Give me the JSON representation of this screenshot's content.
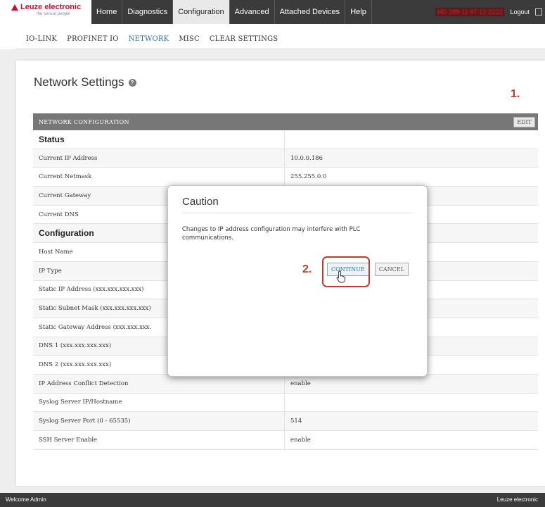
{
  "brand": {
    "name": "Leuze electronic",
    "tagline": "the sensor people"
  },
  "nav": {
    "tabs": [
      "Home",
      "Diagnostics",
      "Configuration",
      "Advanced",
      "Attached Devices",
      "Help"
    ],
    "active": "Configuration",
    "user_info": "MD 288-11-97-12-2222",
    "logout": "Logout"
  },
  "subnav": {
    "items": [
      "IO-LINK",
      "PROFINET IO",
      "NETWORK",
      "MISC",
      "CLEAR SETTINGS"
    ],
    "active": "NETWORK"
  },
  "page": {
    "title": "Network Settings"
  },
  "steps": {
    "one": "1.",
    "two": "2."
  },
  "table": {
    "header": "NETWORK CONFIGURATION",
    "edit_label": "EDIT",
    "rows": [
      {
        "label": "Status",
        "value": "",
        "section": true
      },
      {
        "label": "Current IP Address",
        "value": "10.0.0.186"
      },
      {
        "label": "Current Netmask",
        "value": "255.255.0.0"
      },
      {
        "label": "Current Gateway",
        "value": ""
      },
      {
        "label": "Current DNS",
        "value": ""
      },
      {
        "label": "Configuration",
        "value": "",
        "section": true
      },
      {
        "label": "Host Name",
        "value": ""
      },
      {
        "label": "IP Type",
        "value": ""
      },
      {
        "label": "Static IP Address (xxx.xxx.xxx.xxx)",
        "value": ""
      },
      {
        "label": "Static Subnet Mask (xxx.xxx.xxx.xxx)",
        "value": ""
      },
      {
        "label": "Static Gateway Address (xxx.xxx.xxx.",
        "value": ""
      },
      {
        "label": "DNS 1 (xxx.xxx.xxx.xxx)",
        "value": ""
      },
      {
        "label": "DNS 2 (xxx.xxx.xxx.xxx)",
        "value": ""
      },
      {
        "label": "IP Address Conflict Detection",
        "value": "enable"
      },
      {
        "label": "Syslog Server IP/Hostname",
        "value": ""
      },
      {
        "label": "Syslog Server Port (0 - 65535)",
        "value": "514"
      },
      {
        "label": "SSH Server Enable",
        "value": "enable"
      }
    ]
  },
  "modal": {
    "title": "Caution",
    "message": "Changes to IP address configuration may interfere with PLC communications.",
    "continue_label": "CONTINUE",
    "cancel_label": "CANCEL"
  },
  "footer": {
    "left": "Welcome Admin",
    "right": "Leuze electronic"
  },
  "colors": {
    "accent": "#2a6ea8",
    "brand_red": "#c8102e",
    "highlight": "#c0392b",
    "navbar": "#3b3b3b"
  }
}
